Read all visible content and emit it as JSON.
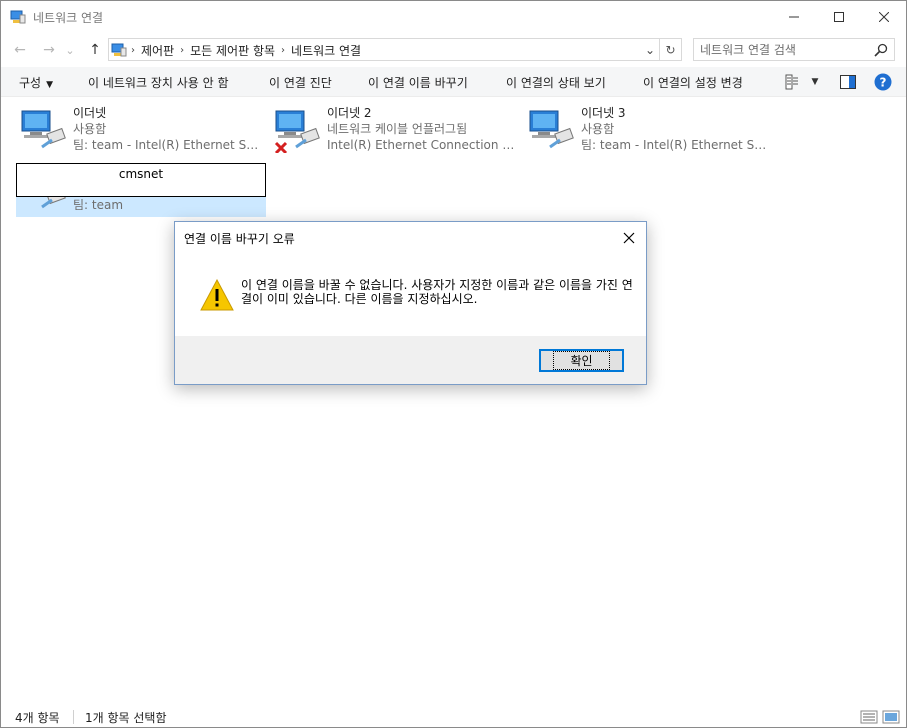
{
  "window": {
    "title": "네트워크 연결",
    "controls": {
      "minimize": "—",
      "maximize": "☐",
      "close": "✕"
    }
  },
  "nav": {
    "back": "←",
    "forward": "→",
    "recent": "⌄",
    "up": "↑",
    "breadcrumbs": [
      "제어판",
      "모든 제어판 항목",
      "네트워크 연결"
    ],
    "breadcrumb_sep": "›",
    "dropdown": "⌄",
    "refresh": "↻",
    "search_placeholder": "네트워크 연결 검색"
  },
  "commands": {
    "organize": "구성",
    "disable": "이 네트워크 장치 사용 안 함",
    "diagnose": "이 연결 진단",
    "rename": "이 연결 이름 바꾸기",
    "status": "이 연결의 상태 보기",
    "settings": "이 연결의 설정 변경",
    "help": "?"
  },
  "items": [
    {
      "name": "이더넷",
      "status": "사용함",
      "device": "팀: team - Intel(R) Ethernet Serve..."
    },
    {
      "name": "이더넷 2",
      "status": "네트워크 케이블 언플러그됨",
      "device": "Intel(R) Ethernet Connection (2) I..."
    },
    {
      "name": "이더넷 3",
      "status": "사용함",
      "device": "팀: team - Intel(R) Ethernet Serve..."
    },
    {
      "name": "cmsnet",
      "status": "",
      "device": "팀: team"
    }
  ],
  "dialog": {
    "title": "연결 이름 바꾸기 오류",
    "close": "✕",
    "message": "이 연결 이름을 바꿀 수 없습니다. 사용자가 지정한 이름과 같은 이름을 가진 연결이 이미 있습니다. 다른 이름을 지정하십시오.",
    "ok": "확인"
  },
  "statusbar": {
    "count": "4개 항목",
    "selected": "1개 항목 선택함"
  }
}
